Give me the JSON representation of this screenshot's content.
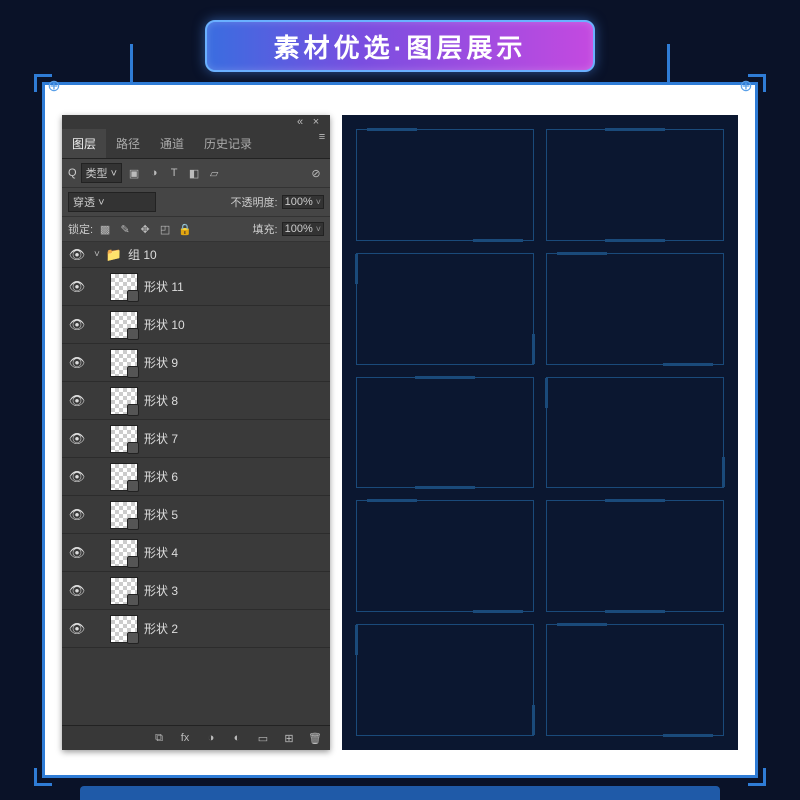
{
  "title": "素材优选·图层展示",
  "panel": {
    "tabs": [
      "图层",
      "路径",
      "通道",
      "历史记录"
    ],
    "active_tab": 0,
    "filter_label": "类型",
    "blend_mode": "穿透",
    "opacity_label": "不透明度:",
    "opacity_value": "100%",
    "lock_label": "锁定:",
    "fill_label": "填充:",
    "fill_value": "100%",
    "group_name": "组 10",
    "layers": [
      {
        "name": "形状 11"
      },
      {
        "name": "形状 10"
      },
      {
        "name": "形状 9"
      },
      {
        "name": "形状 8"
      },
      {
        "name": "形状 7"
      },
      {
        "name": "形状 6"
      },
      {
        "name": "形状 5"
      },
      {
        "name": "形状 4"
      },
      {
        "name": "形状 3"
      },
      {
        "name": "形状 2"
      }
    ],
    "footer_fx": "fx"
  },
  "search_prefix": "Q"
}
